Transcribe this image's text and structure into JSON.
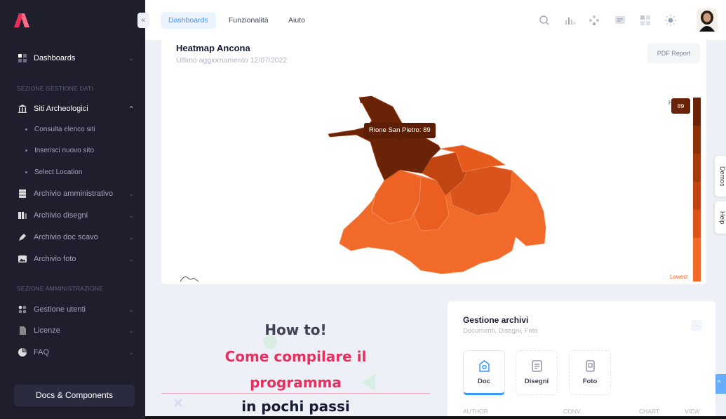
{
  "sidebar": {
    "collapse_glyph": "«",
    "items": [
      {
        "label": "Dashboards",
        "icon": "dashboard-grid-icon"
      },
      {
        "label": "Siti Archeologici",
        "icon": "museum-icon"
      },
      {
        "label": "Archivio amministrativo",
        "icon": "archive-icon"
      },
      {
        "label": "Archivio disegni",
        "icon": "drawings-icon"
      },
      {
        "label": "Archivio doc scavo",
        "icon": "pen-icon"
      },
      {
        "label": "Archivio foto",
        "icon": "photo-icon"
      },
      {
        "label": "Gestione utenti",
        "icon": "users-icon"
      },
      {
        "label": "Licenze",
        "icon": "license-icon"
      },
      {
        "label": "FAQ",
        "icon": "faq-icon"
      }
    ],
    "sections": [
      "SEZIONE GESTIONE DATI",
      "SEZIONE AMMINISTRAZIONE"
    ],
    "sub_items": [
      "Consulta elenco siti",
      "Inserisci nuovo sito",
      "Select Location"
    ],
    "docs_button": "Docs & Components"
  },
  "header": {
    "tabs": [
      "Dashboards",
      "Funzionalità",
      "Aiuto"
    ],
    "icons": [
      "search-icon",
      "chart-icon",
      "apps-icon",
      "chat-icon",
      "layout-icon",
      "theme-sun-icon"
    ]
  },
  "heatmap": {
    "title": "Heatmap Ancona",
    "subtitle": "Ultimo aggiornamento 12/07/2022",
    "pdf_button": "PDF Report",
    "tooltip": "Rione San Pietro: 89",
    "legend_high": "High",
    "legend_low": "Lowest",
    "legend_value": "89",
    "colors": {
      "max": "#6b2307",
      "high": "#b0400f",
      "mid": "#d9531a",
      "low": "#f26a2a"
    },
    "highlighted_value": 89
  },
  "side_tabs": {
    "demos": "Demos",
    "help": "Help"
  },
  "howto": {
    "line1": "How to!",
    "line2": "Come compilare il",
    "line3": "programma",
    "line4": "in pochi passi",
    "color_accent": "#e8305f"
  },
  "archive": {
    "title": "Gestione archivi",
    "subtitle": "Documenti, Disegni, Foto",
    "more": "...",
    "tabs": [
      {
        "label": "Doc",
        "icon": "doc-icon"
      },
      {
        "label": "Disegni",
        "icon": "drawing-file-icon"
      },
      {
        "label": "Foto",
        "icon": "photo-file-icon"
      }
    ],
    "columns": [
      "AUTHOR",
      "CONV.",
      "CHART",
      "VIEW"
    ]
  }
}
